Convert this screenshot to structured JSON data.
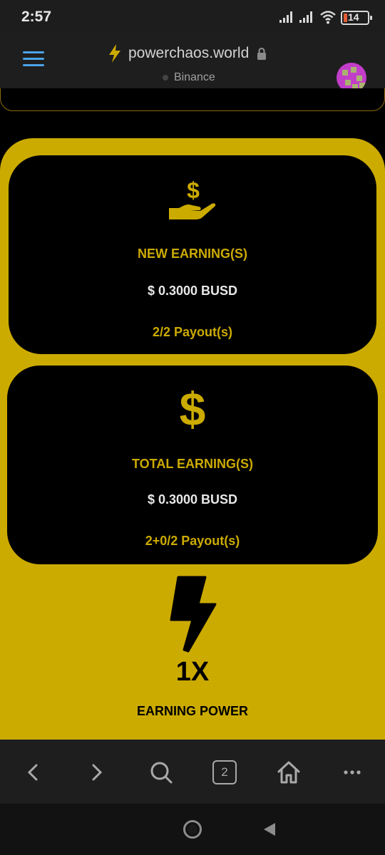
{
  "status_bar": {
    "time": "2:57",
    "battery_level": "14"
  },
  "browser": {
    "site_domain": "powerchaos.world",
    "network": "Binance",
    "open_tabs": "2"
  },
  "cards": [
    {
      "icon": "hand-dollar-icon",
      "title": "NEW EARNING(S)",
      "value": "$ 0.3000 BUSD",
      "payout": "2/2 Payout(s)"
    },
    {
      "icon": "dollar-icon",
      "title": "TOTAL EARNING(S)",
      "value": "$ 0.3000 BUSD",
      "payout": "2+0/2 Payout(s)"
    }
  ],
  "power": {
    "icon": "lightning-bolt-icon",
    "multiplier": "1X",
    "label": "EARNING POWER"
  },
  "colors": {
    "accent": "#ccab00",
    "card_bg": "#000000",
    "link_blue": "#4ba3e8"
  }
}
